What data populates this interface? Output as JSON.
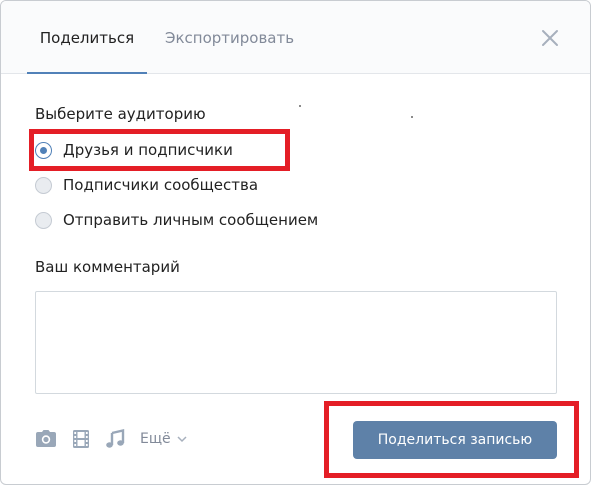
{
  "tabs": [
    {
      "label": "Поделиться",
      "active": true
    },
    {
      "label": "Экспортировать",
      "active": false
    }
  ],
  "audience": {
    "title": "Выберите аудиторию",
    "options": [
      {
        "label": "Друзья и подписчики",
        "checked": true
      },
      {
        "label": "Подписчики сообщества",
        "checked": false
      },
      {
        "label": "Отправить личным сообщением",
        "checked": false
      }
    ]
  },
  "comment": {
    "title": "Ваш комментарий",
    "value": ""
  },
  "toolbar": {
    "icons": [
      "camera-icon",
      "film-icon",
      "music-note-icon"
    ],
    "more_label": "Ещё"
  },
  "share_button_label": "Поделиться записью",
  "colors": {
    "accent": "#5181b8",
    "button": "#5e81a8",
    "highlight": "#e41e26",
    "icon": "#99a7b8"
  }
}
